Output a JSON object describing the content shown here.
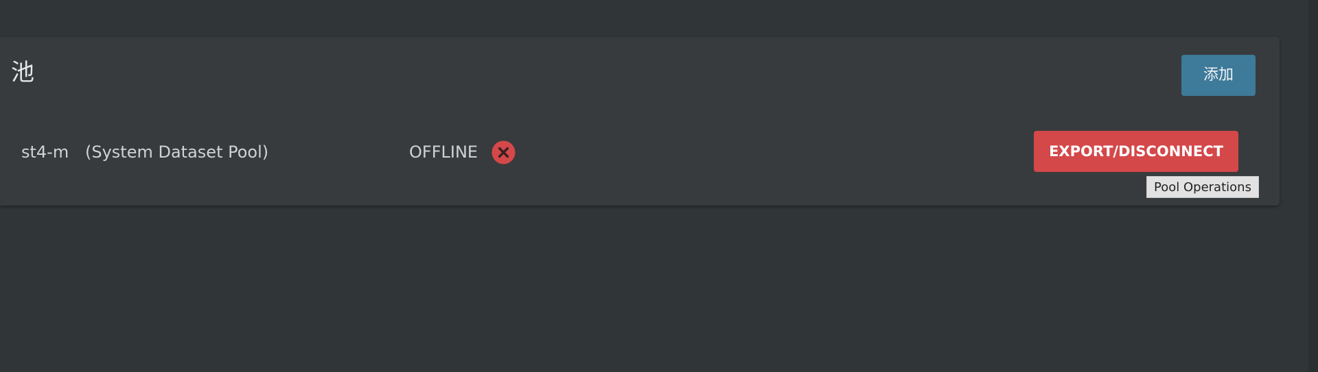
{
  "pools_card": {
    "title": "池",
    "add_button_label": "添加"
  },
  "pool": {
    "name": "st4-m",
    "description": "(System Dataset Pool)",
    "status": "OFFLINE",
    "status_icon": "close-circle-icon",
    "status_color": "#d4484a",
    "export_button_label": "EXPORT/DISCONNECT",
    "export_tooltip": "Pool Operations"
  },
  "colors": {
    "background": "#303537",
    "card": "#373b3d",
    "add_button": "#3e7a99",
    "danger": "#d4484a"
  }
}
